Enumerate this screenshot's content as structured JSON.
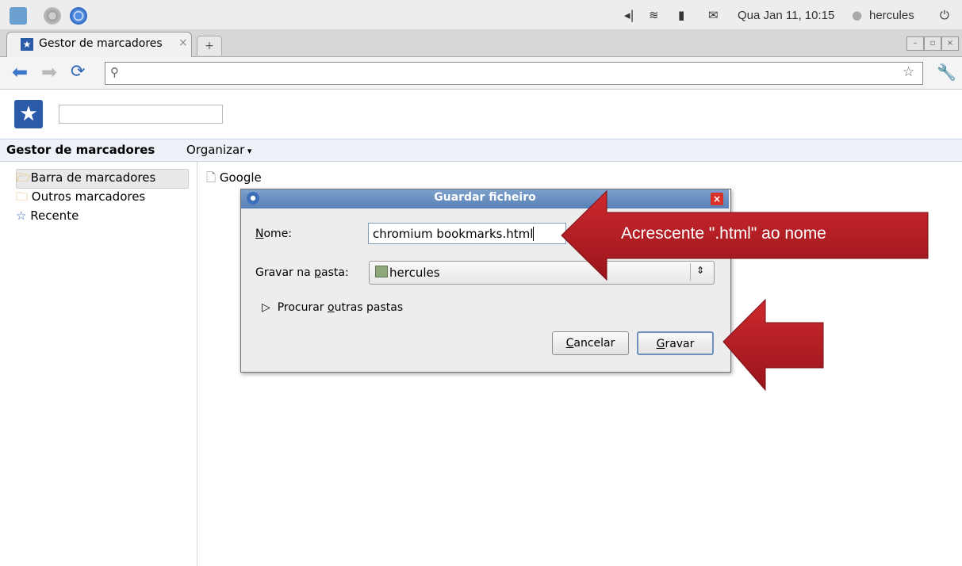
{
  "system_panel": {
    "datetime": "Qua Jan 11, 10:15",
    "user": "hercules",
    "icons": [
      "home-icon",
      "chromium-icon",
      "chrome-icon",
      "volume-icon",
      "wifi-icon",
      "battery-icon",
      "mail-icon",
      "chat-icon",
      "power-icon"
    ]
  },
  "browser": {
    "tab_title": "Gestor de marcadores",
    "tab_close": "×",
    "new_tab": "+",
    "address_value": ""
  },
  "bookmark_manager": {
    "title": "Gestor de marcadores",
    "organize_menu": "Organizar",
    "search_value": "",
    "tree": [
      {
        "label": "Barra de marcadores",
        "icon": "folder-open-icon",
        "selected": true
      },
      {
        "label": "Outros marcadores",
        "icon": "folder-icon",
        "selected": false
      },
      {
        "label": "Recente",
        "icon": "star-icon",
        "selected": false
      }
    ],
    "list": [
      {
        "label": "Google",
        "icon": "page-icon"
      }
    ]
  },
  "dialog": {
    "title": "Guardar ficheiro",
    "name_label_underlined": "N",
    "name_label_rest": "ome:",
    "name_value": "chromium bookmarks.html",
    "folder_label_start": "Gravar na ",
    "folder_label_underlined": "p",
    "folder_label_end": "asta:",
    "folder_value": "hercules",
    "browse_label_start": "Procurar ",
    "browse_label_underlined": "o",
    "browse_label_end": "utras pastas",
    "cancel_underlined": "C",
    "cancel_rest": "ancelar",
    "save_underlined": "G",
    "save_rest": "ravar"
  },
  "annotation": {
    "callout_text": "Acrescente \".html\" ao nome",
    "arrow_color": "#b01b22"
  }
}
